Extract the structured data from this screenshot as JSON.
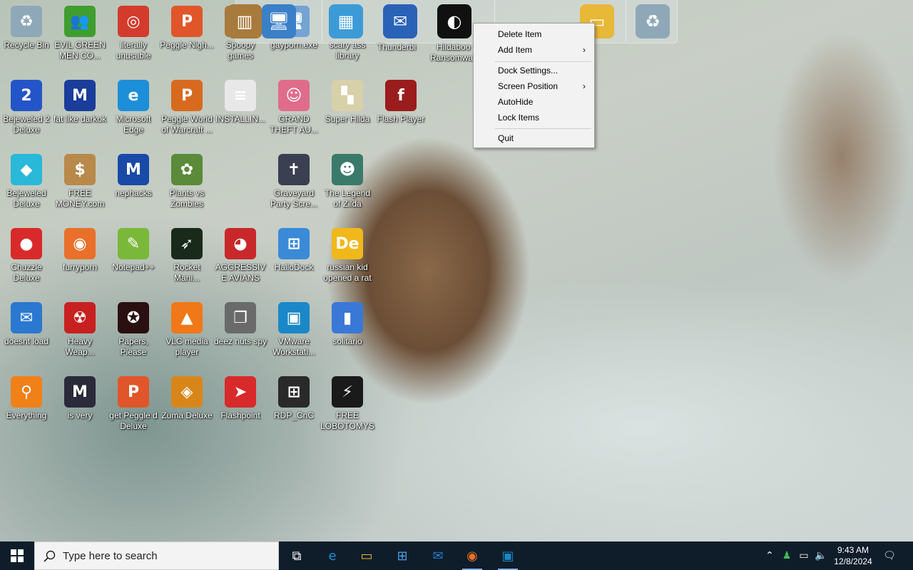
{
  "desktop": {
    "icons": [
      {
        "label": "Recycle Bin",
        "icon": "recycle-bin-icon",
        "color": "#8fa8b8",
        "glyph": "♻"
      },
      {
        "label": "EVIL GREEN MEN CO...",
        "icon": "green-people-icon",
        "color": "#3f9e2f",
        "glyph": "👥"
      },
      {
        "label": "literally unusable",
        "icon": "chrome-icon",
        "color": "#d33b2c",
        "glyph": "◎"
      },
      {
        "label": "Peggle Nigh...",
        "icon": "peggle-icon",
        "color": "#e0562a",
        "glyph": "P"
      },
      {
        "label": "Spoopy games",
        "icon": "books-icon",
        "color": "#a87a3c",
        "glyph": "▥"
      },
      {
        "label": "gayporn.exe",
        "icon": "network-computers-icon",
        "color": "#3a7fc8",
        "glyph": "🖥"
      },
      {
        "label": "scary ass library",
        "icon": "library-icon",
        "color": "#3c9bd6",
        "glyph": "▦"
      },
      {
        "label": "Bejeweled 2 Deluxe",
        "icon": "bejeweled2-icon",
        "color": "#2455c8",
        "glyph": "2"
      },
      {
        "label": "fat like darkok",
        "icon": "mpi-icon",
        "color": "#1a3c9a",
        "glyph": "M"
      },
      {
        "label": "Microsoft Edge",
        "icon": "edge-icon",
        "color": "#1c8fd8",
        "glyph": "e"
      },
      {
        "label": "Peggle World of Warcraft ...",
        "icon": "peggle-wow-icon",
        "color": "#d86a1f",
        "glyph": "P"
      },
      {
        "label": "INSTALLIN...",
        "icon": "text-document-icon",
        "color": "#e8e8e8",
        "glyph": "≡"
      },
      {
        "label": "GRAND THEFT AU...",
        "icon": "anime-girl-icon",
        "color": "#e06c8c",
        "glyph": "☺"
      },
      {
        "label": "Super Hilda",
        "icon": "pixel-art-icon",
        "color": "#d8d0a8",
        "glyph": "▚"
      },
      {
        "label": "Flash Player",
        "icon": "flash-icon",
        "color": "#9b1c1c",
        "glyph": "f"
      },
      {
        "label": "Bejeweled Deluxe",
        "icon": "diamond-icon",
        "color": "#2ab8d8",
        "glyph": "◆"
      },
      {
        "label": "FREE MONEY.com",
        "icon": "money-bag-icon",
        "color": "#b8894a",
        "glyph": "$"
      },
      {
        "label": "nephacks",
        "icon": "mpi-icon",
        "color": "#1a4aa8",
        "glyph": "M"
      },
      {
        "label": "Plants vs Zombies",
        "icon": "flower-icon",
        "color": "#5a8a3a",
        "glyph": "✿"
      },
      {
        "label": "Graveyard Party Scre...",
        "icon": "graveyard-icon",
        "color": "#3a3f52",
        "glyph": "✝"
      },
      {
        "label": "The Legend of Zilda",
        "icon": "pixel-hero-icon",
        "color": "#3a7a6a",
        "glyph": "☻"
      },
      {
        "label": "Chuzzle Deluxe",
        "icon": "chuzzle-icon",
        "color": "#d82a2a",
        "glyph": "●"
      },
      {
        "label": "furryporn",
        "icon": "firefox-icon",
        "color": "#e8702a",
        "glyph": "◉"
      },
      {
        "label": "Notepad++",
        "icon": "notepadpp-icon",
        "color": "#7ab83a",
        "glyph": "✎"
      },
      {
        "label": "Rocket Mani...",
        "icon": "rocket-icon",
        "color": "#1a2a1a",
        "glyph": "➶"
      },
      {
        "label": "AGGRESSIVE AVIANS",
        "icon": "angry-bird-icon",
        "color": "#c8282a",
        "glyph": "◕"
      },
      {
        "label": "HalloDock",
        "icon": "windows-shield-icon",
        "color": "#3a8ad8",
        "glyph": "⊞"
      },
      {
        "label": "russian kid opened a rat",
        "icon": "de-icon",
        "color": "#f0b81a",
        "glyph": "De"
      },
      {
        "label": "doesnt load",
        "icon": "bird-globe-icon",
        "color": "#2a78d0",
        "glyph": "✉"
      },
      {
        "label": "Heavy Weap...",
        "icon": "radiation-icon",
        "color": "#c82020",
        "glyph": "☢"
      },
      {
        "label": "Papers, Please",
        "icon": "papers-please-icon",
        "color": "#2a1010",
        "glyph": "✪"
      },
      {
        "label": "VLC media player",
        "icon": "vlc-icon",
        "color": "#f07818",
        "glyph": "▲"
      },
      {
        "label": "deez nuts spy",
        "icon": "windows-stack-icon",
        "color": "#6a6a6a",
        "glyph": "❐"
      },
      {
        "label": "VMware Workstati...",
        "icon": "vmware-icon",
        "color": "#1a88c8",
        "glyph": "▣"
      },
      {
        "label": "solitario",
        "icon": "bottle-icon",
        "color": "#3a78d8",
        "glyph": "▮"
      },
      {
        "label": "Everything",
        "icon": "magnifier-icon",
        "color": "#f08018",
        "glyph": "⚲"
      },
      {
        "label": "is very",
        "icon": "mpi-shield-icon",
        "color": "#2a2a3a",
        "glyph": "M"
      },
      {
        "label": "get Peggle d Deluxe",
        "icon": "peggle-icon",
        "color": "#e0562a",
        "glyph": "P"
      },
      {
        "label": "Zuma Deluxe",
        "icon": "zuma-icon",
        "color": "#d8861a",
        "glyph": "◈"
      },
      {
        "label": "Flashpoint",
        "icon": "flashpoint-icon",
        "color": "#d82a2a",
        "glyph": "➤"
      },
      {
        "label": "RDP_CnC",
        "icon": "rdp-icon",
        "color": "#2a2a2a",
        "glyph": "⊞"
      },
      {
        "label": "FREE LOBOTOMYS",
        "icon": "lobotomy-icon",
        "color": "#1a1a1a",
        "glyph": "⚡"
      }
    ]
  },
  "dock": {
    "items": [
      {
        "name": "dock-item-spoopy",
        "icon": "books-icon",
        "color": "#a87a3c",
        "glyph": "▥"
      },
      {
        "name": "dock-item-gayporn",
        "icon": "network-computers-icon",
        "color": "#3a7fc8",
        "glyph": "🖥"
      },
      {
        "name": "dock-item-library",
        "icon": "library-icon",
        "color": "#3c9bd6",
        "glyph": "▦"
      },
      {
        "name": "dock-item-thunderbird",
        "icon": "thunderbird-icon",
        "color": "#2a62b8",
        "glyph": "✉"
      },
      {
        "name": "dock-item-hildaboo",
        "icon": "hildaboo-icon",
        "color": "#101010",
        "glyph": "◐"
      },
      {
        "name": "dock-item-folder",
        "icon": "folder-icon",
        "color": "#e8b838",
        "glyph": "▭"
      },
      {
        "name": "dock-item-recycle",
        "icon": "recycle-bin-icon",
        "color": "#8fa8b8",
        "glyph": "♻"
      }
    ],
    "tooltip_partial_1": "Thunderbi",
    "tooltip_partial_2": "Hildaboo",
    "tooltip_partial_3": "Ransomwa"
  },
  "context_menu": {
    "delete_item": "Delete Item",
    "add_item": "Add Item",
    "dock_settings": "Dock Settings...",
    "screen_position": "Screen Position",
    "autohide": "AutoHide",
    "lock_items": "Lock Items",
    "quit": "Quit",
    "submenu_arrow": "›"
  },
  "taskbar": {
    "search_placeholder": "Type here to search",
    "apps": [
      {
        "name": "taskview",
        "icon": "task-view-icon",
        "glyph": "⧉",
        "color": "#ffffff"
      },
      {
        "name": "edge",
        "icon": "edge-icon",
        "glyph": "e",
        "color": "#1c8fd8"
      },
      {
        "name": "file-explorer",
        "icon": "folder-icon",
        "glyph": "▭",
        "color": "#e8b838"
      },
      {
        "name": "store",
        "icon": "store-icon",
        "glyph": "⊞",
        "color": "#4aa0e8"
      },
      {
        "name": "mail",
        "icon": "mail-icon",
        "glyph": "✉",
        "color": "#2a78d0"
      },
      {
        "name": "firefox",
        "icon": "firefox-icon",
        "glyph": "◉",
        "color": "#e8702a"
      },
      {
        "name": "hallodock",
        "icon": "vmware-icon",
        "glyph": "▣",
        "color": "#1a88c8"
      }
    ],
    "clock_time": "9:43 AM",
    "clock_date": "12/8/2024"
  }
}
